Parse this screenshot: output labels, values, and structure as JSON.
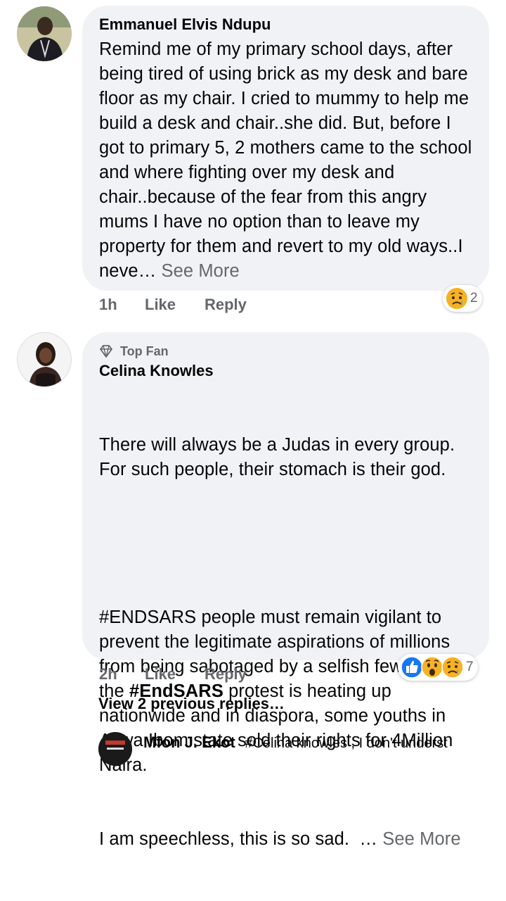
{
  "comments": [
    {
      "author": "Emmanuel Elvis Ndupu",
      "text": "Remind me of my primary school days, after being tired of using brick as my desk and bare floor as my chair. I cried to mummy to help me build a desk and chair..she did. But, before I got to primary 5, 2 mothers came to the school and where fighting over my desk and chair..because of the fear from this angry mums I have no option than to leave my property for them and revert to my old ways..I neve…",
      "see_more": "See More",
      "time": "1h",
      "like_label": "Like",
      "reply_label": "Reply",
      "reaction_count": "2",
      "reactions": [
        "sad-emoji"
      ]
    },
    {
      "badge_icon": "diamond-icon",
      "badge": "Top Fan",
      "author": "Celina Knowles",
      "text_p1": "There will always be a Judas in every group. For such people, their stomach is their god.",
      "text_p2_a": "#ENDSARS people must remain vigilant to prevent the legitimate aspirations of millions from being sabotaged by a selfish few. While the ",
      "text_p2_hashtag": "#EndSARS",
      "text_p2_b": " protest is heating up nationwide and in diaspora, some youths in Akwa Ibom state sold their rights for 4Million Naira.",
      "text_p3": "I am speechless, this is so sad.  …",
      "see_more": "See More",
      "time": "2h",
      "like_label": "Like",
      "reply_label": "Reply",
      "reaction_count": "7",
      "reactions": [
        "like-icon",
        "wow-emoji",
        "sad-emoji"
      ]
    }
  ],
  "view_previous_replies": "View 2 previous replies…",
  "reply_preview": {
    "author": "Mfon J. Ekot",
    "text": "#Celina knowles , I don't underst"
  },
  "colors": {
    "bubble": "#f0f2f5",
    "secondary_text": "#65676b",
    "like_blue": "#1877f2",
    "emoji_yellow": "#f7b125"
  }
}
